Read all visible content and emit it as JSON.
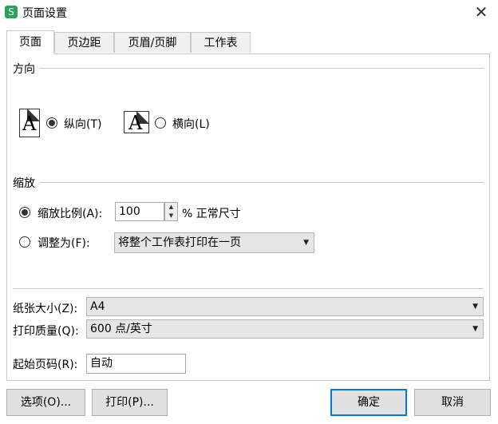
{
  "window": {
    "app_icon_glyph": "S",
    "title": "页面设置",
    "close_glyph": "✕"
  },
  "tabs": [
    {
      "label": "页面",
      "active": true
    },
    {
      "label": "页边距",
      "active": false
    },
    {
      "label": "页眉/页脚",
      "active": false
    },
    {
      "label": "工作表",
      "active": false
    }
  ],
  "orientation": {
    "group_label": "方向",
    "portrait": {
      "glyph": "A",
      "label": "纵向(T)",
      "selected": true
    },
    "landscape": {
      "glyph": "A",
      "label": "横向(L)",
      "selected": false
    }
  },
  "scaling": {
    "group_label": "缩放",
    "scale_radio": {
      "label": "缩放比例(A):",
      "selected": true
    },
    "scale_value": "100",
    "scale_suffix": "% 正常尺寸",
    "fit_radio": {
      "label": "调整为(F):",
      "selected": false
    },
    "fit_value": "将整个工作表打印在一页",
    "spin_up": "▲",
    "spin_down": "▼",
    "caret": "▼"
  },
  "paper": {
    "paper_size_label": "纸张大小(Z):",
    "paper_size_value": "A4",
    "print_quality_label": "打印质量(Q):",
    "print_quality_value": "600 点/英寸",
    "first_page_label": "起始页码(R):",
    "first_page_value": "自动"
  },
  "buttons": {
    "options": "选项(O)...",
    "print": "打印(P)...",
    "ok": "确定",
    "cancel": "取消"
  },
  "colors": {
    "accent": "#0078d7",
    "app_icon": "#2aa35a"
  }
}
